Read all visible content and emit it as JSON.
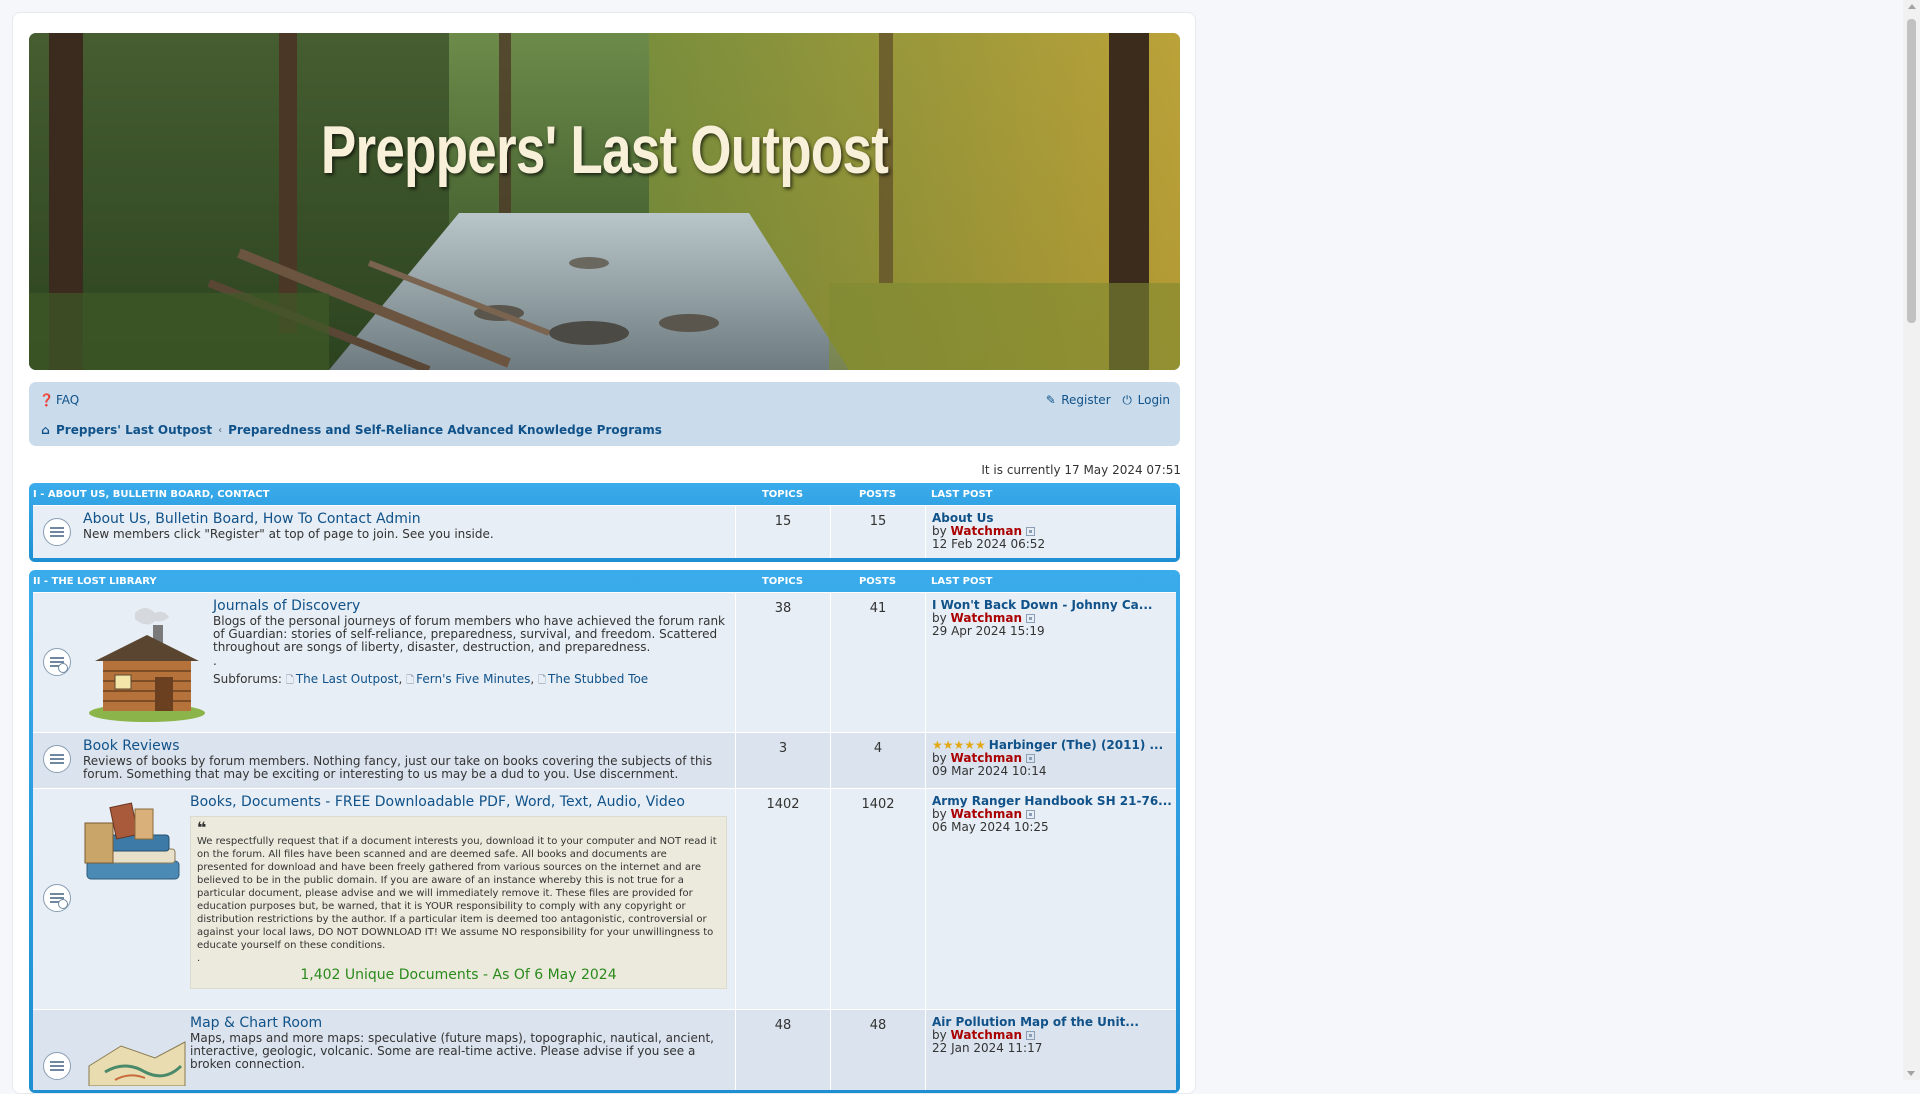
{
  "site": {
    "title": "Preppers' Last Outpost"
  },
  "nav": {
    "faq": "FAQ",
    "register": "Register",
    "login": "Login",
    "crumbs": [
      "Preppers' Last Outpost",
      "Preparedness and Self-Reliance Advanced Knowledge Programs"
    ]
  },
  "time_text": "It is currently 17 May 2024 07:51",
  "columns": {
    "topics": "TOPICS",
    "posts": "POSTS",
    "last_post": "LAST POST"
  },
  "categories": [
    {
      "name": "I - ABOUT US, BULLETIN BOARD, CONTACT",
      "forums": [
        {
          "title": "About Us, Bulletin Board, How To Contact Admin",
          "desc": "New members click \"Register\" at top of page to join. See you inside.",
          "topics": "15",
          "posts": "15",
          "last_title": "About Us",
          "by": "by",
          "last_user": "Watchman",
          "last_date": "12 Feb 2024 06:52"
        }
      ]
    },
    {
      "name": "II - THE LOST LIBRARY",
      "forums": [
        {
          "title": "Journals of Discovery",
          "desc": "Blogs of the personal journeys of forum members who have achieved the forum rank of Guardian: stories of self-reliance, preparedness, survival, and freedom. Scattered throughout are songs of liberty, disaster, destruction, and preparedness.",
          "desc_dot": ".",
          "subforums_label": "Subforums:",
          "subforums": [
            "The Last Outpost",
            "Fern's Five Minutes",
            "The Stubbed Toe"
          ],
          "topics": "38",
          "posts": "41",
          "last_title": "I Won't Back Down - Johnny Ca...",
          "by": "by",
          "last_user": "Watchman",
          "last_date": "29 Apr 2024 15:19"
        },
        {
          "title": "Book Reviews",
          "desc": "Reviews of books by forum members. Nothing fancy, just our take on books covering the subjects of this forum. Something that may be exciting or interesting to us may be a dud to you. Use discernment.",
          "topics": "3",
          "posts": "4",
          "last_stars": "★★★★★",
          "last_title": "Harbinger (The) (2011) ...",
          "by": "by",
          "last_user": "Watchman",
          "last_date": "09 Mar 2024 10:14"
        },
        {
          "title": "Books, Documents - FREE Downloadable PDF, Word, Text, Audio, Video",
          "quote": "We respectfully request that if a document interests you, download it to your computer and NOT read it on the forum. All files have been scanned and are deemed safe. All books and documents are presented for download and have been freely gathered from various sources on the internet and are believed to be in the public domain. If you are aware of an instance whereby this is not true for a particular document, please advise and we will immediately remove it. These files are provided for education purposes but, be warned, that it is YOUR responsibility to comply with any copyright or distribution restrictions by the author. If a particular item is deemed too antagonistic, controversial or against your local laws, DO NOT DOWNLOAD IT! We assume NO responsibility for your unwillingness to educate yourself on these conditions.",
          "quote_dot": ".",
          "green_note": "1,402 Unique Documents - As Of 6 May 2024",
          "topics": "1402",
          "posts": "1402",
          "last_title": "Army Ranger Handbook SH 21-76...",
          "by": "by",
          "last_user": "Watchman",
          "last_date": "06 May 2024 10:25"
        },
        {
          "title": "Map & Chart Room",
          "desc": "Maps, maps and more maps: speculative (future maps), topographic, nautical, ancient, interactive, geologic, volcanic. Some are real-time active. Please advise if you see a broken connection.",
          "topics": "48",
          "posts": "48",
          "last_title": "Air Pollution Map of the Unit...",
          "by": "by",
          "last_user": "Watchman",
          "last_date": "22 Jan 2024 11:17"
        }
      ]
    }
  ],
  "colors": {
    "link": "#105289",
    "user": "#aa0000",
    "category_bar": "#1e8fd2",
    "green_note": "#2b8a1c"
  },
  "icons": [
    "question-icon",
    "edit-icon",
    "power-icon",
    "home-icon",
    "forum-read-icon",
    "subforum-icon",
    "view-post-icon",
    "quote-icon",
    "star-icon"
  ]
}
